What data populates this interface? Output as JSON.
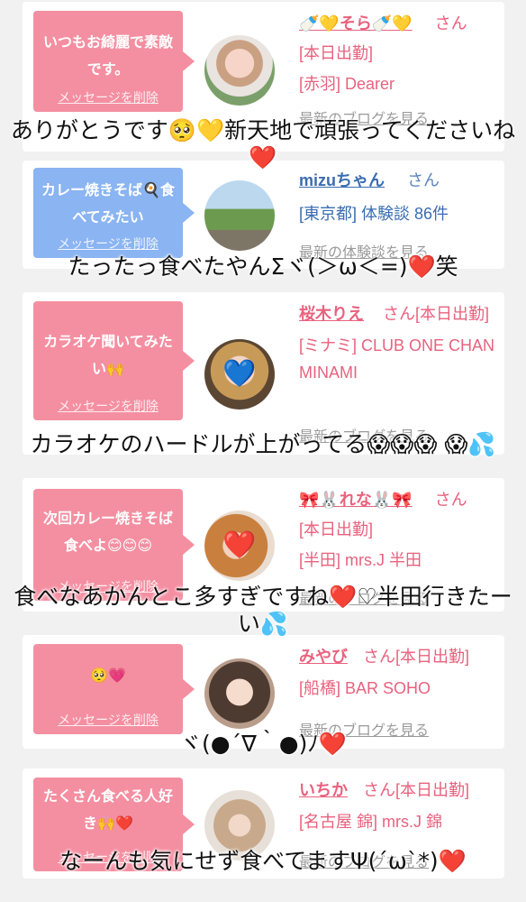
{
  "cards": [
    {
      "bubble": "いつもお綺麗で素敵です。",
      "delete": "メッセージを削除",
      "name": "🍼💛そら🍼💛",
      "san": "さん",
      "line1": "[本日出勤]",
      "line2": "[赤羽] Dearer",
      "link": "最新のブログを見る"
    },
    {
      "bubble": "カレー焼きそば🍳食べてみたい",
      "delete": "メッセージを削除",
      "name": "mizuちゃん",
      "san": "さん",
      "line1": "[東京都] 体験談 86件",
      "link": "最新の体験談を見る"
    },
    {
      "bubble": "カラオケ聞いてみたい🙌",
      "delete": "メッセージを削除",
      "name": "桜木りえ",
      "san": "さん[本日出勤]",
      "line1": "[ミナミ] CLUB ONE CHAN MINAMI",
      "link": "最新のブログを見る",
      "sticker": "💙"
    },
    {
      "bubble": "次回カレー焼きそば食べよ😊😊😊",
      "delete": "メッセージを削除",
      "name": "🎀🐰れな🐰🎀",
      "san": "さん",
      "line1": "[本日出勤]",
      "line2": "[半田] mrs.J 半田",
      "link": "最新のブログを見る",
      "sticker": "❤️"
    },
    {
      "bubble": "🥺💗",
      "delete": "メッセージを削除",
      "name": "みやび",
      "san": "さん[本日出勤]",
      "line1": "[船橋] BAR SOHO",
      "link": "最新のブログを見る"
    },
    {
      "bubble": "たくさん食べる人好き🙌❤️",
      "delete": "メッセージを削除",
      "name": "いちか",
      "san": "さん[本日出勤]",
      "line1": "[名古屋 錦] mrs.J 錦",
      "link": "最新のブログを見る"
    }
  ],
  "captions": [
    "ありがとうです🥺💛新天地で頑張ってくださいね❤️",
    "たったっ食べたやんΣヾ(＞ω＜=)❤️笑",
    "カラオケのハードルが上がってる😱😱😱 😱💦",
    "食べなあかんとこ多すぎですね❤️♡半田行きたーい💦",
    "ヾ(●´∇｀●)ﾉ❤️",
    "なーんも気にせず食べてますΨ(´ω`*)❤️"
  ]
}
